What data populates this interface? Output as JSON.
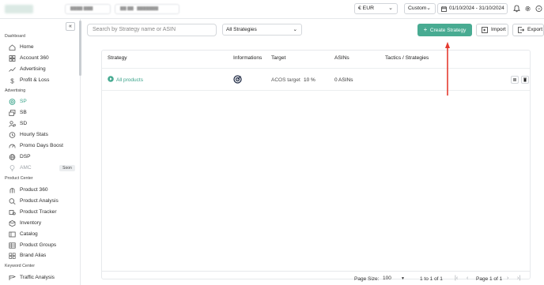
{
  "topbar": {
    "currency": "€ EUR",
    "range_preset": "Custom",
    "date_range": "01/10/2024 - 31/10/2024",
    "icons": [
      "bell-icon",
      "gear-icon",
      "help-icon"
    ]
  },
  "sidebar": {
    "collapse_label": "«",
    "sections": [
      {
        "title": "Dashboard",
        "items": [
          {
            "label": "Home",
            "icon": "home-icon"
          },
          {
            "label": "Account 360",
            "icon": "grid-icon"
          },
          {
            "label": "Advertising",
            "icon": "trend-icon"
          },
          {
            "label": "Profit & Loss",
            "icon": "dollar-icon"
          }
        ]
      },
      {
        "title": "Advertising",
        "items": [
          {
            "label": "SP",
            "icon": "target-icon",
            "active": true
          },
          {
            "label": "SB",
            "icon": "layers-icon"
          },
          {
            "label": "SD",
            "icon": "user-target-icon"
          },
          {
            "label": "Hourly Stats",
            "icon": "clock-icon"
          },
          {
            "label": "Promo Days Boost",
            "icon": "speedometer-icon"
          },
          {
            "label": "DSP",
            "icon": "globe-icon"
          },
          {
            "label": "AMC",
            "icon": "bulb-icon",
            "disabled": true,
            "badge": "Soon"
          }
        ]
      },
      {
        "title": "Product Center",
        "items": [
          {
            "label": "Product 360",
            "icon": "product-icon"
          },
          {
            "label": "Product Analysis",
            "icon": "search-chart-icon"
          },
          {
            "label": "Product Tracker",
            "icon": "tracker-icon"
          },
          {
            "label": "Inventory",
            "icon": "box-icon"
          },
          {
            "label": "Catalog",
            "icon": "catalog-icon"
          },
          {
            "label": "Product Groups",
            "icon": "groups-icon"
          },
          {
            "label": "Brand Alias",
            "icon": "brand-icon"
          }
        ]
      },
      {
        "title": "Keyword Center",
        "items": [
          {
            "label": "Traffic Analysis",
            "icon": "traffic-icon"
          }
        ]
      }
    ]
  },
  "toolbar": {
    "search_placeholder": "Search by Strategy name or ASIN",
    "filter_value": "All Strategies",
    "create_label": "Create Strategy",
    "import_label": "Import",
    "export_label": "Export"
  },
  "table": {
    "headers": [
      "Strategy",
      "Informations",
      "Target",
      "ASINs",
      "Tactics / Strategies"
    ],
    "rows": [
      {
        "strategy": "All products",
        "info_icon": "strategy-target-icon",
        "target_label": "ACOS target",
        "target_value": "10 %",
        "asins": "0 ASINs"
      }
    ]
  },
  "footer": {
    "page_size_label": "Page Size:",
    "page_size": "100",
    "range_text": "1 to 1 of 1",
    "page_text": "Page 1 of 1"
  },
  "colors": {
    "accent": "#48ab92",
    "annotation_arrow": "#e53a2f"
  }
}
